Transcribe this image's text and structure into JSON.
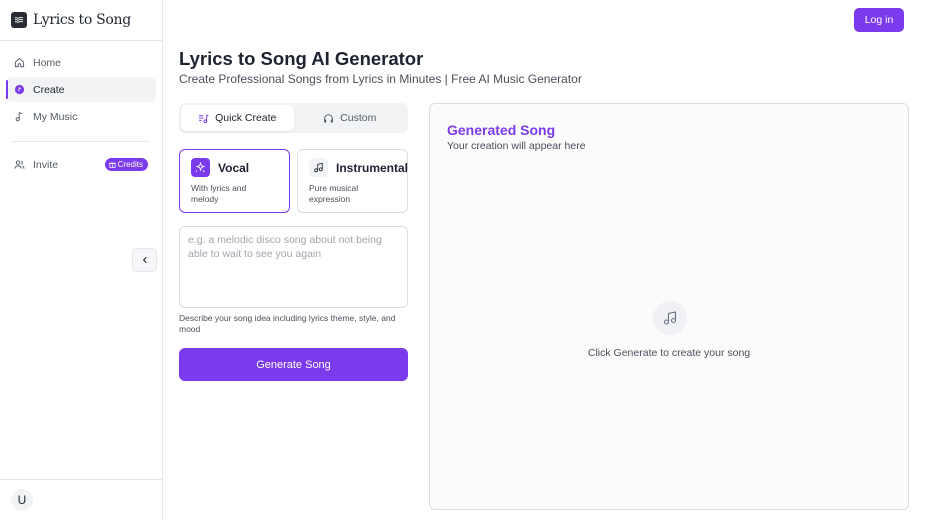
{
  "brand": {
    "name": "Lyrics to Song"
  },
  "sidebar": {
    "items": [
      {
        "label": "Home",
        "icon": "home-icon"
      },
      {
        "label": "Create",
        "icon": "create-icon"
      },
      {
        "label": "My Music",
        "icon": "music-note-icon"
      }
    ],
    "invite": {
      "label": "Invite",
      "icon": "users-icon",
      "badge": "Credits"
    },
    "user_initial": "U"
  },
  "header": {
    "login_label": "Log in"
  },
  "main": {
    "title": "Lyrics to Song AI Generator",
    "subtitle": "Create Professional Songs from Lyrics in Minutes | Free AI Music Generator",
    "tabs": [
      {
        "label": "Quick Create",
        "icon": "music-list-icon",
        "active": true
      },
      {
        "label": "Custom",
        "icon": "headphones-icon",
        "active": false
      }
    ],
    "modes": [
      {
        "title": "Vocal",
        "description": "With lyrics and melody",
        "icon": "sparkle-icon",
        "selected": true
      },
      {
        "title": "Instrumental",
        "description": "Pure musical expression",
        "icon": "music-note-icon",
        "selected": false
      }
    ],
    "prompt": {
      "value": "",
      "placeholder": "e.g. a melodic disco song about not being able to wait to see you again",
      "help": "Describe your song idea including lyrics theme, style, and mood"
    },
    "generate_label": "Generate Song"
  },
  "output": {
    "title": "Generated Song",
    "subtitle": "Your creation will appear here",
    "empty_text": "Click Generate to create your song"
  },
  "colors": {
    "accent": "#7c3aed",
    "border": "#dcdde2",
    "text": "#1f2330"
  }
}
